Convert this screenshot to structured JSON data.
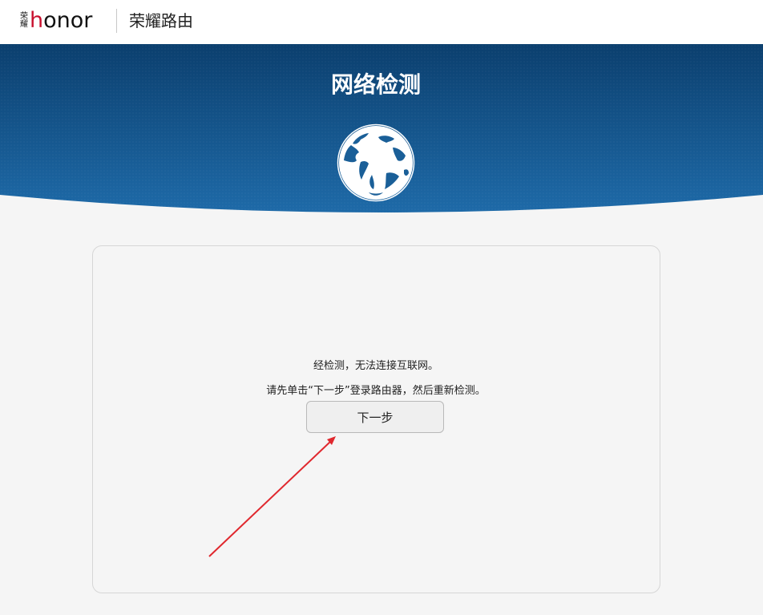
{
  "header": {
    "logo_cn_top": "荣",
    "logo_cn_bottom": "耀",
    "logo_en_first": "h",
    "logo_en_rest": "onor",
    "product_name": "荣耀路由"
  },
  "banner": {
    "title": "网络检测",
    "icon": "globe-icon",
    "colors": {
      "dark": "#0b3f6e",
      "light": "#1e6aa8"
    }
  },
  "panel": {
    "message_line1": "经检测，无法连接互联网。",
    "message_line2": "请先单击“下一步”登录路由器，然后重新检测。",
    "next_button": "下一步"
  },
  "annotation": {
    "arrow_color": "#e0282e"
  }
}
